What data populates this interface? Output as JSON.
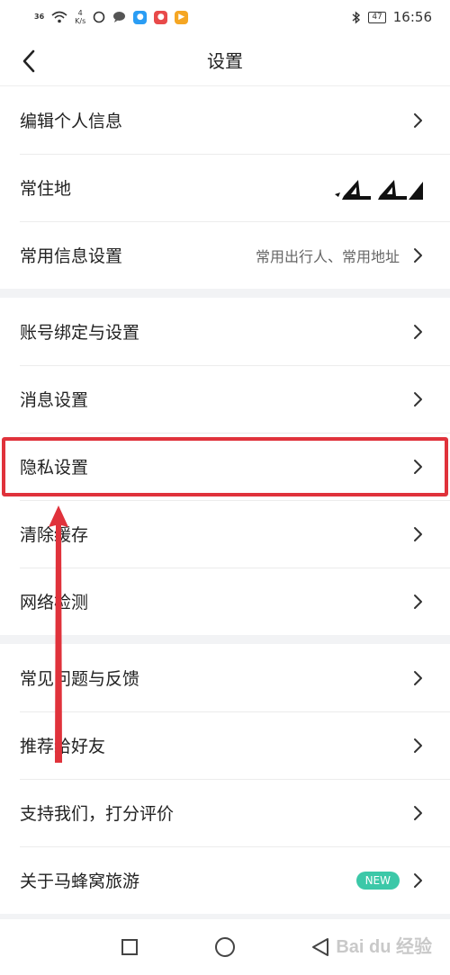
{
  "status_bar": {
    "signal": "36",
    "speed_value": "4",
    "speed_unit": "K/s",
    "battery": "47",
    "time": "16:56"
  },
  "nav": {
    "title": "设置"
  },
  "sections": [
    {
      "items": [
        {
          "label": "编辑个人信息"
        },
        {
          "label": "常住地"
        },
        {
          "label": "常用信息设置",
          "value": "常用出行人、常用地址"
        }
      ]
    },
    {
      "items": [
        {
          "label": "账号绑定与设置"
        },
        {
          "label": "消息设置"
        },
        {
          "label": "隐私设置"
        },
        {
          "label": "清除缓存"
        },
        {
          "label": "网络检测"
        }
      ]
    },
    {
      "items": [
        {
          "label": "常见问题与反馈"
        },
        {
          "label": "推荐给好友"
        },
        {
          "label": "支持我们，打分评价"
        },
        {
          "label": "关于马蜂窝旅游",
          "badge": "NEW"
        }
      ]
    }
  ],
  "watermark": "Bai du 经验",
  "colors": {
    "highlight": "#e0323b",
    "badge": "#3cc8a8"
  }
}
